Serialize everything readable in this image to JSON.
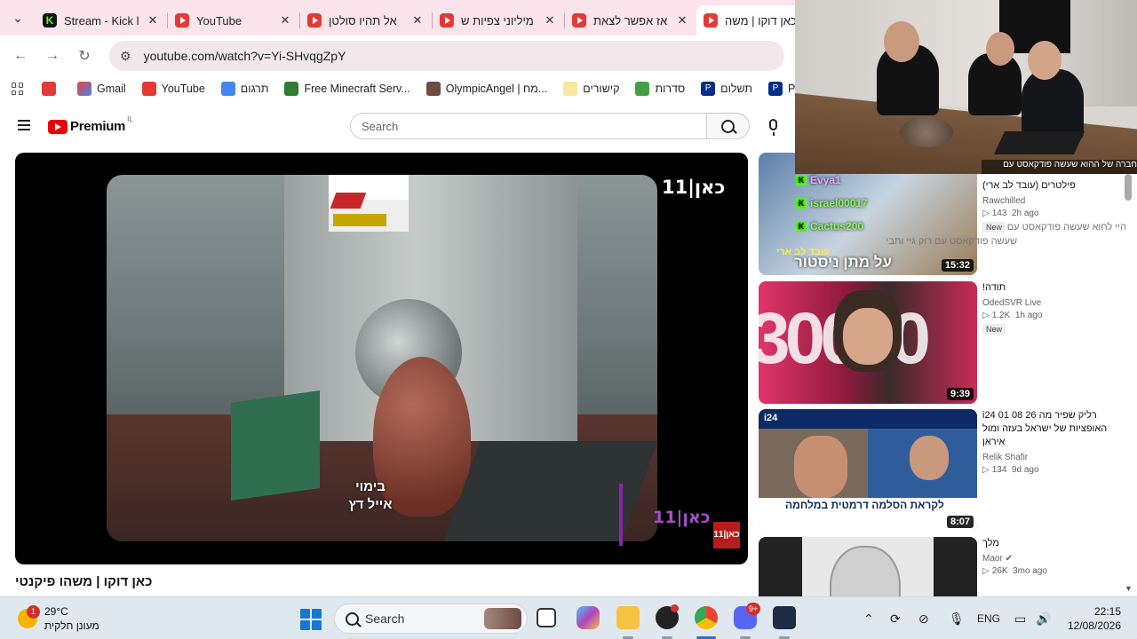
{
  "browser": {
    "tabs": [
      {
        "title": "Stream - Kick l",
        "icon": "kick-icon"
      },
      {
        "title": "YouTube",
        "icon": "youtube-icon"
      },
      {
        "title": "אל תהיו סולטן",
        "icon": "youtube-icon"
      },
      {
        "title": "מיליוני צפיות ש",
        "icon": "youtube-icon"
      },
      {
        "title": "אז אפשר לצאת",
        "icon": "youtube-icon"
      },
      {
        "title": "כאן דוקו | משה",
        "icon": "youtube-icon"
      }
    ],
    "url": "youtube.com/watch?v=Yi-SHvqgZpY",
    "bookmarks": [
      {
        "label": "Gmail"
      },
      {
        "label": "YouTube"
      },
      {
        "label": "תרגום"
      },
      {
        "label": "Free Minecraft Serv..."
      },
      {
        "label": "OlympicAngel | מח..."
      },
      {
        "label": "קישורים"
      },
      {
        "label": "סדרות"
      },
      {
        "label": "תשלום"
      },
      {
        "label": "Payl"
      }
    ]
  },
  "youtube": {
    "logo_text": "Premium",
    "country_code": "IL",
    "search_placeholder": "Search",
    "video_title": "כאן דוקו | משהו פיקנטי",
    "player": {
      "kan_logo": "כאן|11",
      "credit_line1": "בימוי",
      "credit_line2": "אייל דץ",
      "kan_logo_small": "כאן|11",
      "badge": "כאן|11"
    },
    "recommendations": [
      {
        "title": "פילטרים (עובד לב ארי)",
        "channel": "Rawchilled",
        "views": "143",
        "age": "2h ago",
        "badge": "New",
        "duration": "15:32",
        "thumb_text": "על מתן ניסטור",
        "thumb_text2": "עובד לב ארי"
      },
      {
        "title": "תודה!",
        "channel": "OdedSVR Live",
        "views": "1.2K",
        "age": "1h ago",
        "badge": "New",
        "duration": "9:39",
        "thumb_text": "30000"
      },
      {
        "title": "i24 01 08 26 רליק שפיר מה האופציות של ישראל בעזה ומול איראן",
        "channel": "Relik Shafir",
        "views": "134",
        "age": "9d ago",
        "duration": "8:07",
        "thumb_text": "לקראת הסלמה דרמטית במלחמה",
        "thumb_logo": "i24"
      },
      {
        "title": "מלך",
        "channel": "Maor",
        "views": "26K",
        "age": "3mo ago"
      }
    ]
  },
  "chat_overlay": [
    {
      "user": "Evya1",
      "msg": ""
    },
    {
      "user": "israel00017",
      "msg": ""
    },
    {
      "user": "Cactus200",
      "msg": ""
    }
  ],
  "overlay_text": {
    "top": "חברה של ההוא שעשה פודקאסט עם",
    "line2": "היי לחוא שעשה פודקאסט עם",
    "line3": "שעשה פודקאסט עם רוק גיי ותבי"
  },
  "taskbar": {
    "temp": "29°C",
    "weather_desc": "מעונן חלקית",
    "weather_badge": "1",
    "search_label": "Search",
    "discord_badge": "9+",
    "lang": "ENG",
    "time": "22:15",
    "date": "12/08/2026"
  }
}
